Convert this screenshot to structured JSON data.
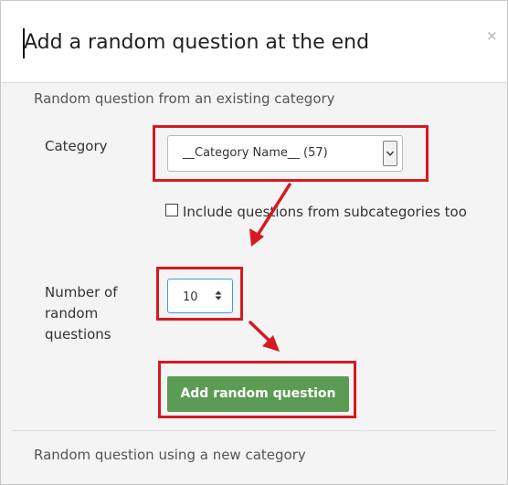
{
  "dialog": {
    "title": "Add a random question at the end",
    "close_symbol": "×"
  },
  "existing_category_section": {
    "heading": "Random question from an existing category",
    "category_label": "Category",
    "category_selected": "__Category Name__ (57)",
    "include_subcategories_label": "Include questions from subcategories too",
    "include_subcategories_checked": false,
    "number_label": "Number of random questions",
    "number_value": "10",
    "submit_label": "Add random question"
  },
  "new_category_section": {
    "heading": "Random question using a new category"
  },
  "icons": {
    "close": "close-icon",
    "select_arrow": "chevron-down-icon",
    "number_spinner": "up-down-spinner-icon",
    "annotation_arrows": "arrow-icon"
  },
  "colors": {
    "primary_button": "#5b9b54",
    "annotation": "#d71920",
    "input_focus": "#3e9bd8",
    "dialog_body": "#f4f4f4"
  }
}
